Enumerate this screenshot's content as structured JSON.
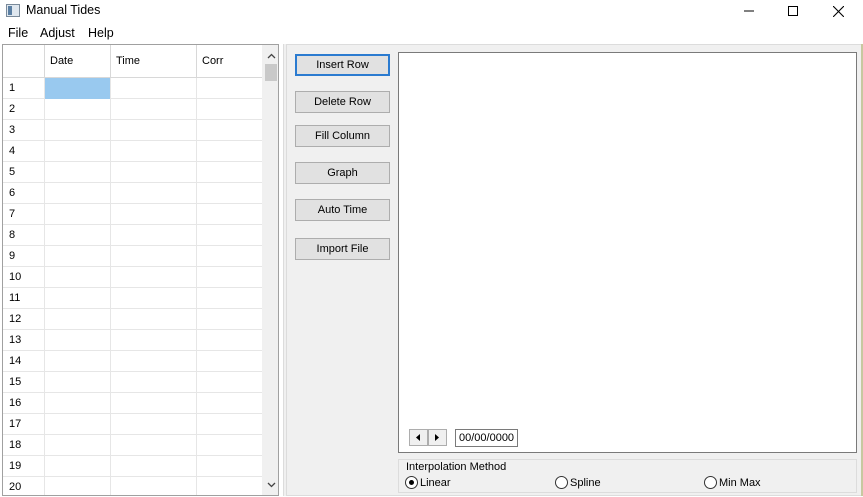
{
  "window": {
    "title": "Manual Tides"
  },
  "menu": {
    "items": [
      "File",
      "Adjust",
      "Help"
    ]
  },
  "grid": {
    "columns": [
      "Date",
      "Time",
      "Corr"
    ],
    "rows": [
      "1",
      "2",
      "3",
      "4",
      "5",
      "6",
      "7",
      "8",
      "9",
      "10",
      "11",
      "12",
      "13",
      "14",
      "15",
      "16",
      "17",
      "18",
      "19",
      "20"
    ]
  },
  "buttons": {
    "insert_row": "Insert Row",
    "delete_row": "Delete Row",
    "fill_column": "Fill Column",
    "graph": "Graph",
    "auto_time": "Auto Time",
    "import_file": "Import File"
  },
  "plot": {
    "date_value": "00/00/0000"
  },
  "interpolation": {
    "legend": "Interpolation Method",
    "options": [
      "Linear",
      "Spline",
      "Min Max"
    ],
    "selected": "Linear"
  },
  "colors": {
    "selection": "#99c9ef",
    "focus_border": "#2b7bd0",
    "panel_bg": "#f0f0f0"
  }
}
